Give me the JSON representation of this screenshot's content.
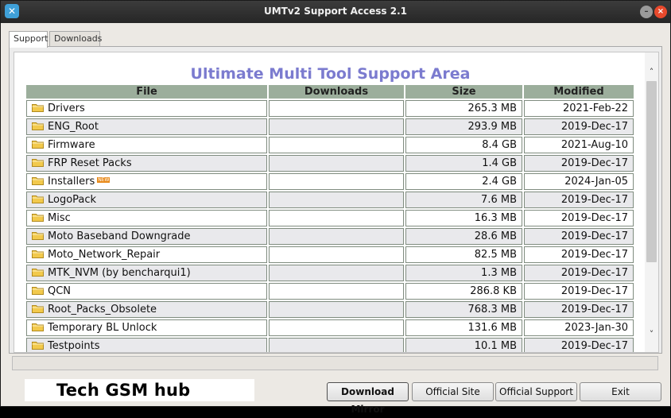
{
  "window": {
    "title": "UMTv2 Support Access 2.1",
    "app_icon": "wrench-icon",
    "controls": {
      "minimize": "–",
      "maximize": "□",
      "close": "×"
    }
  },
  "tabs": [
    {
      "label": "Support",
      "active": true
    },
    {
      "label": "Downloads",
      "active": false
    }
  ],
  "support_area": {
    "heading": "Ultimate Multi Tool Support Area",
    "columns": [
      "File",
      "Downloads",
      "Size",
      "Modified"
    ],
    "rows": [
      {
        "file": "Drivers",
        "downloads": "",
        "size": "265.3 MB",
        "modified": "2021-Feb-22"
      },
      {
        "file": "ENG_Root",
        "downloads": "",
        "size": "293.9 MB",
        "modified": "2019-Dec-17"
      },
      {
        "file": "Firmware",
        "downloads": "",
        "size": "8.4 GB",
        "modified": "2021-Aug-10"
      },
      {
        "file": "FRP Reset Packs",
        "downloads": "",
        "size": "1.4 GB",
        "modified": "2019-Dec-17"
      },
      {
        "file": "Installers",
        "downloads": "",
        "size": "2.4 GB",
        "modified": "2024-Jan-05",
        "badge": "NEW"
      },
      {
        "file": "LogoPack",
        "downloads": "",
        "size": "7.6 MB",
        "modified": "2019-Dec-17"
      },
      {
        "file": "Misc",
        "downloads": "",
        "size": "16.3 MB",
        "modified": "2019-Dec-17"
      },
      {
        "file": "Moto Baseband Downgrade",
        "downloads": "",
        "size": "28.6 MB",
        "modified": "2019-Dec-17"
      },
      {
        "file": "Moto_Network_Repair",
        "downloads": "",
        "size": "82.5 MB",
        "modified": "2019-Dec-17"
      },
      {
        "file": "MTK_NVM (by bencharqui1)",
        "downloads": "",
        "size": "1.3 MB",
        "modified": "2019-Dec-17"
      },
      {
        "file": "QCN",
        "downloads": "",
        "size": "286.8 KB",
        "modified": "2019-Dec-17"
      },
      {
        "file": "Root_Packs_Obsolete",
        "downloads": "",
        "size": "768.3 MB",
        "modified": "2019-Dec-17"
      },
      {
        "file": "Temporary BL Unlock",
        "downloads": "",
        "size": "131.6 MB",
        "modified": "2023-Jan-30"
      },
      {
        "file": "Testpoints",
        "downloads": "",
        "size": "10.1 MB",
        "modified": "2019-Dec-17"
      }
    ],
    "row_icon": "folder-icon",
    "colors": {
      "heading": "#7b7bcf",
      "header_bg": "#9cae9c",
      "folder": "#f2c94c"
    }
  },
  "scrollbar": {
    "up": "˄",
    "down": "˅"
  },
  "footer": {
    "brand_text": "Tech GSM hub",
    "buttons": {
      "download_mirror": "Download Mirror",
      "official_site": "Official Site",
      "official_support": "Official Support",
      "exit": "Exit"
    }
  }
}
